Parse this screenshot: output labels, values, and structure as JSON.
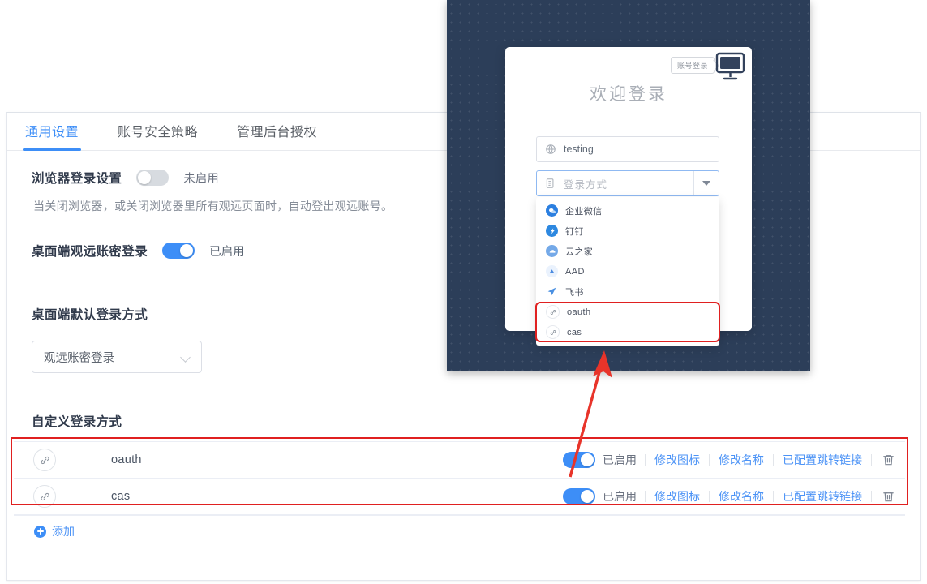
{
  "settings_panel": {
    "tabs": [
      {
        "label": "通用设置",
        "active": true
      },
      {
        "label": "账号安全策略",
        "active": false
      },
      {
        "label": "管理后台授权",
        "active": false
      }
    ],
    "browser_login": {
      "title": "浏览器登录设置",
      "toggle_state": "off",
      "toggle_label": "未启用",
      "description": "当关闭浏览器，或关闭浏览器里所有观远页面时，自动登出观远账号。"
    },
    "desktop_password_login": {
      "title": "桌面端观远账密登录",
      "toggle_state": "on",
      "toggle_label": "已启用"
    },
    "desktop_default_login": {
      "title": "桌面端默认登录方式",
      "selected": "观远账密登录"
    },
    "custom_login": {
      "title": "自定义登录方式",
      "rows": [
        {
          "icon": "link-icon",
          "name": "oauth",
          "toggle_state": "on",
          "status_label": "已启用",
          "actions": [
            "修改图标",
            "修改名称",
            "已配置跳转链接"
          ],
          "delete_icon": "trash-icon"
        },
        {
          "icon": "link-icon",
          "name": "cas",
          "toggle_state": "on",
          "status_label": "已启用",
          "actions": [
            "修改图标",
            "修改名称",
            "已配置跳转链接"
          ],
          "delete_icon": "trash-icon"
        }
      ],
      "add_label": "添加"
    }
  },
  "login_dialog": {
    "tooltip": "账号登录",
    "tooltip_icon": "monitor-icon",
    "heading": "欢迎登录",
    "server_field": {
      "icon": "globe-icon",
      "value": "testing"
    },
    "method_select": {
      "icon": "list-icon",
      "placeholder": "登录方式",
      "value": "",
      "caret_icon": "caret-down-icon",
      "options": [
        {
          "label": "企业微信",
          "icon": "wecom-icon",
          "highlighted": false
        },
        {
          "label": "钉钉",
          "icon": "dingtalk-icon",
          "highlighted": false
        },
        {
          "label": "云之家",
          "icon": "yunzhijia-icon",
          "highlighted": false
        },
        {
          "label": "AAD",
          "icon": "aad-icon",
          "highlighted": false
        },
        {
          "label": "飞书",
          "icon": "feishu-icon",
          "highlighted": false
        },
        {
          "label": "oauth",
          "icon": "link-icon",
          "highlighted": true
        },
        {
          "label": "cas",
          "icon": "link-icon",
          "highlighted": true
        }
      ]
    }
  },
  "annotations": {
    "highlight_color": "#e02020",
    "arrow_icon": "arrow-up-left-icon"
  },
  "colors": {
    "accent_blue": "#3d8ef7",
    "link_blue": "#4c93f6",
    "toggle_off": "#d7dbe0",
    "dialog_backdrop": "#2c3e59",
    "highlight_red": "#e02020"
  }
}
